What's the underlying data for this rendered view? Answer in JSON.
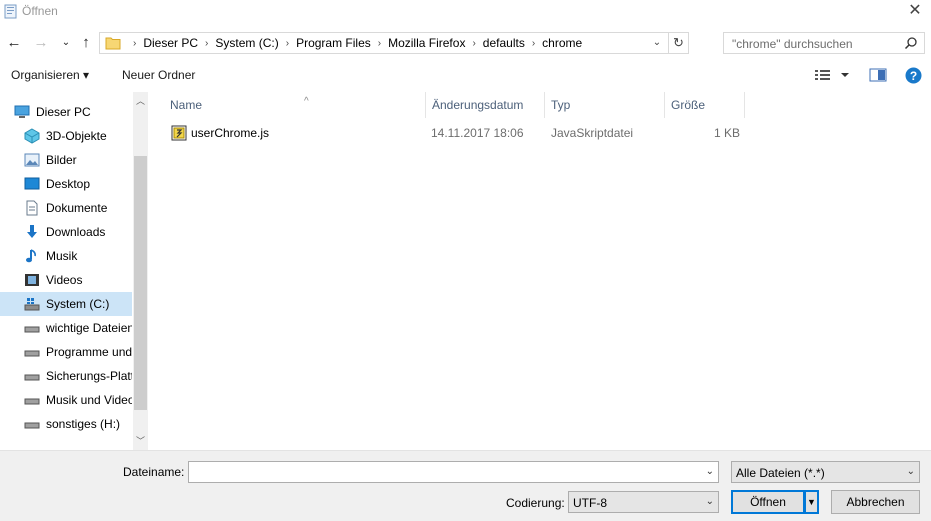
{
  "window": {
    "title": "Öffnen"
  },
  "address": {
    "crumbs": [
      "Dieser PC",
      "System (C:)",
      "Program Files",
      "Mozilla Firefox",
      "defaults",
      "chrome"
    ]
  },
  "search": {
    "placeholder": "\"chrome\" durchsuchen"
  },
  "toolbar": {
    "organize_label": "Organisieren ▾",
    "new_folder_label": "Neuer Ordner"
  },
  "nav": {
    "items": [
      {
        "label": "Dieser PC",
        "icon": "pc-icon"
      },
      {
        "label": "3D-Objekte",
        "icon": "3d-objects-icon"
      },
      {
        "label": "Bilder",
        "icon": "pictures-icon"
      },
      {
        "label": "Desktop",
        "icon": "desktop-icon"
      },
      {
        "label": "Dokumente",
        "icon": "documents-icon"
      },
      {
        "label": "Downloads",
        "icon": "downloads-icon"
      },
      {
        "label": "Musik",
        "icon": "music-icon"
      },
      {
        "label": "Videos",
        "icon": "videos-icon"
      },
      {
        "label": "System (C:)",
        "icon": "system-drive-icon"
      },
      {
        "label": "wichtige Dateien",
        "icon": "drive-icon"
      },
      {
        "label": "Programme und",
        "icon": "drive-icon"
      },
      {
        "label": "Sicherungs-Platt",
        "icon": "drive-icon"
      },
      {
        "label": "Musik und Video",
        "icon": "drive-icon"
      },
      {
        "label": "sonstiges (H:)",
        "icon": "drive-icon"
      }
    ]
  },
  "columns": {
    "name": "Name",
    "date": "Änderungsdatum",
    "type": "Typ",
    "size": "Größe"
  },
  "files": [
    {
      "name": "userChrome.js",
      "date": "14.11.2017 18:06",
      "type": "JavaSkriptdatei",
      "size": "1 KB"
    }
  ],
  "bottom": {
    "filename_label": "Dateiname:",
    "filename_value": "",
    "filter_value": "Alle Dateien  (*.*)",
    "encoding_label": "Codierung:",
    "encoding_value": "UTF-8",
    "open_label": "Öffnen",
    "cancel_label": "Abbrechen"
  },
  "colors": {
    "accent": "#0078d7",
    "selected_bg": "#cce4f7",
    "header_text": "#4c607a"
  }
}
